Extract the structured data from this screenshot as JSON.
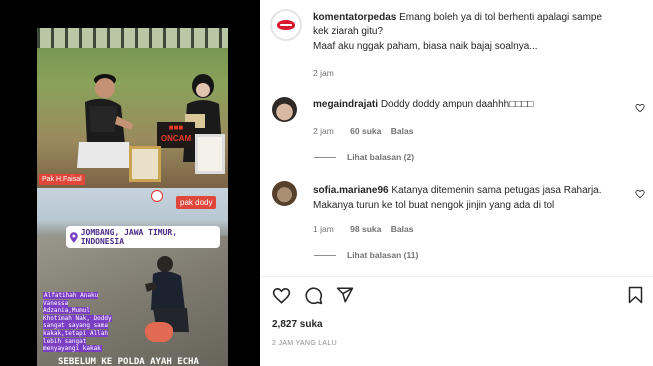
{
  "post": {
    "author": "komentatorpedas",
    "caption_line1": "Emang boleh ya di tol berhenti apalagi sampe",
    "caption_line2": "kek ziarah gitu?",
    "caption_line3": "Maaf aku nggak paham, biasa naik bajaj soalnya...",
    "time": "2 jam",
    "likes": "2,827 suka",
    "posted_ago": "2 JAM YANG LALU"
  },
  "comments": [
    {
      "username": "megaindrajati",
      "text": "Doddy doddy ampun daahhh□□□□",
      "time": "2 jam",
      "likes": "60 suka",
      "reply_label": "Balas",
      "view_replies": "Lihat balasan (2)"
    },
    {
      "username": "sofia.mariane96",
      "text_line1": "Katanya ditemenin sama petugas jasa Raharja.",
      "text_line2": "Makanya turun ke tol buat nengok jinjin yang ada di tol",
      "time": "1 jam",
      "likes": "98 suka",
      "reply_label": "Balas",
      "view_replies": "Lihat balasan (11)"
    }
  ],
  "media": {
    "tag_top": "Pak H.Faisal",
    "sign_text": "ONCAM",
    "tag_bottom": "pak dody",
    "location": "JOMBANG, JAWA TIMUR, INDONESIA",
    "overlay_caption": "Alfatihah Anaku Vanessa Adzania,Mumul Khotimah Nak, Doddy sangat sayang sama kakak,tetapi Allah lebih sangat menyayangi kakak",
    "bottom_title": "SEBELUM KE POLDA AYAH ECHA"
  },
  "icons": {
    "like": "heart-icon",
    "comment": "comment-icon",
    "share": "send-icon",
    "save": "bookmark-icon",
    "comment_like": "heart-small-icon"
  },
  "colors": {
    "accent_red": "#e0463a",
    "location_purple": "#7b3fc4",
    "text": "#262626",
    "muted": "#737373"
  }
}
